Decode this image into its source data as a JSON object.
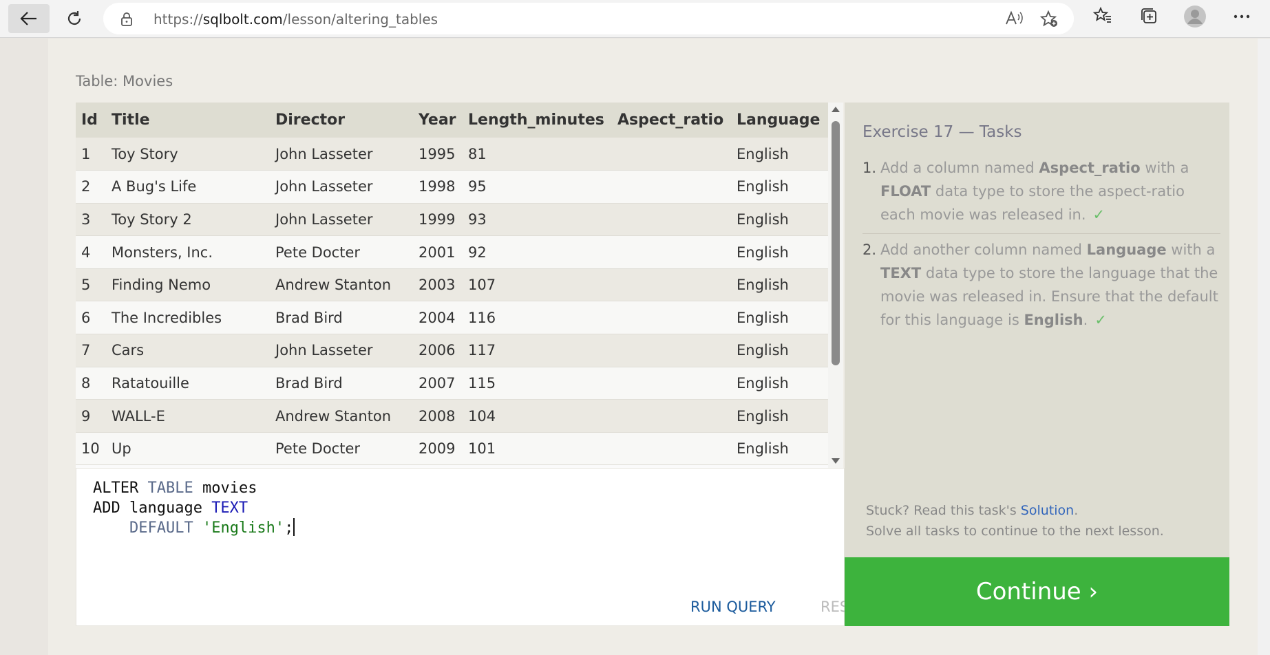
{
  "browser": {
    "url_prefix": "https://",
    "url_domain": "sqlbolt.com",
    "url_path": "/lesson/altering_tables"
  },
  "page": {
    "table_caption": "Table: Movies",
    "table": {
      "headers": [
        "Id",
        "Title",
        "Director",
        "Year",
        "Length_minutes",
        "Aspect_ratio",
        "Language"
      ],
      "rows": [
        [
          "1",
          "Toy Story",
          "John Lasseter",
          "1995",
          "81",
          "",
          "English"
        ],
        [
          "2",
          "A Bug's Life",
          "John Lasseter",
          "1998",
          "95",
          "",
          "English"
        ],
        [
          "3",
          "Toy Story 2",
          "John Lasseter",
          "1999",
          "93",
          "",
          "English"
        ],
        [
          "4",
          "Monsters, Inc.",
          "Pete Docter",
          "2001",
          "92",
          "",
          "English"
        ],
        [
          "5",
          "Finding Nemo",
          "Andrew Stanton",
          "2003",
          "107",
          "",
          "English"
        ],
        [
          "6",
          "The Incredibles",
          "Brad Bird",
          "2004",
          "116",
          "",
          "English"
        ],
        [
          "7",
          "Cars",
          "John Lasseter",
          "2006",
          "117",
          "",
          "English"
        ],
        [
          "8",
          "Ratatouille",
          "Brad Bird",
          "2007",
          "115",
          "",
          "English"
        ],
        [
          "9",
          "WALL-E",
          "Andrew Stanton",
          "2008",
          "104",
          "",
          "English"
        ],
        [
          "10",
          "Up",
          "Pete Docter",
          "2009",
          "101",
          "",
          "English"
        ]
      ]
    },
    "editor": {
      "line1_a": "ALTER ",
      "line1_kw": "TABLE",
      "line1_b": " movies",
      "line2_a": "ADD language ",
      "line2_ty": "TEXT",
      "line3_indent": "    ",
      "line3_kw": "DEFAULT",
      "line3_sp": " ",
      "line3_str": "'English'",
      "line3_end": ";",
      "run_label": "RUN QUERY",
      "reset_label": "RESET"
    },
    "tasks": {
      "title": "Exercise 17 — Tasks",
      "items": [
        {
          "num": "1.",
          "t1": "Add a column named ",
          "b1": "Aspect_ratio",
          "t2": " with a ",
          "b2": "FLOAT",
          "t3": " data type to store the aspect-ratio each movie was released in.",
          "check": "✓"
        },
        {
          "num": "2.",
          "t1": "Add another column named ",
          "b1": "Language",
          "t2": " with a ",
          "b2": "TEXT",
          "t3": " data type to store the language that the movie was released in. Ensure that the default for this language is ",
          "b3": "English",
          "t4": ".",
          "check": "✓"
        }
      ],
      "stuck_prefix": "Stuck? Read this task's ",
      "solution_link": "Solution",
      "stuck_suffix": ".",
      "solve_all": "Solve all tasks to continue to the next lesson.",
      "continue_label": "Continue ›"
    }
  }
}
